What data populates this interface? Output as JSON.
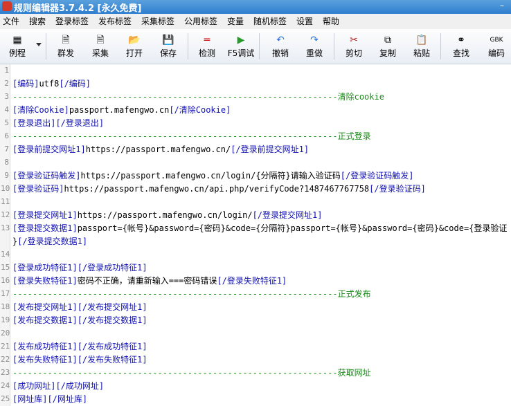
{
  "window": {
    "title": "规则编辑器3.7.4.2 [永久免费]"
  },
  "menu": [
    "文件",
    "搜索",
    "登录标签",
    "发布标签",
    "采集标签",
    "公用标签",
    "变量",
    "随机标签",
    "设置",
    "帮助"
  ],
  "toolbar": [
    {
      "label": "例程",
      "icon": "grid-icon"
    },
    {
      "label": "群发",
      "icon": "document-icon"
    },
    {
      "label": "采集",
      "icon": "document-icon"
    },
    {
      "label": "打开",
      "icon": "folder-open-icon"
    },
    {
      "label": "保存",
      "icon": "save-icon"
    },
    {
      "label": "检测",
      "icon": "check-icon"
    },
    {
      "label": "F5调试",
      "icon": "play-icon"
    },
    {
      "label": "撤销",
      "icon": "undo-icon"
    },
    {
      "label": "重做",
      "icon": "redo-icon"
    },
    {
      "label": "剪切",
      "icon": "scissors-icon"
    },
    {
      "label": "复制",
      "icon": "copy-icon"
    },
    {
      "label": "粘贴",
      "icon": "paste-icon"
    },
    {
      "label": "查找",
      "icon": "binoculars-icon"
    },
    {
      "label": "编码",
      "icon": "encoding-icon",
      "icon_text": "GBK"
    }
  ],
  "editor": {
    "lines": [
      {
        "no": "1",
        "text": ""
      },
      {
        "no": "2",
        "text": "[编码]utf8[/编码]"
      },
      {
        "no": "3",
        "text": "-----------------------------------------------------------------清除cookie"
      },
      {
        "no": "4",
        "text": "[清除Cookie]passport.mafengwo.cn[/清除Cookie]"
      },
      {
        "no": "5",
        "text": "[登录退出][/登录退出]"
      },
      {
        "no": "6",
        "text": "-----------------------------------------------------------------正式登录"
      },
      {
        "no": "7",
        "text": "[登录前提交网址1]https://passport.mafengwo.cn/[/登录前提交网址1]"
      },
      {
        "no": "8",
        "text": ""
      },
      {
        "no": "9",
        "text": "[登录验证码触发]https://passport.mafengwo.cn/login/{分隔符}请输入验证码[/登录验证码触发]"
      },
      {
        "no": "10",
        "text": "[登录验证码]https://passport.mafengwo.cn/api.php/verifyCode?1487467767758[/登录验证码]"
      },
      {
        "no": "11",
        "text": ""
      },
      {
        "no": "12",
        "text": "[登录提交网址1]https://passport.mafengwo.cn/login/[/登录提交网址1]"
      },
      {
        "no": "13",
        "text": "[登录提交数据1]passport={帐号}&password={密码}&code={分隔符}passport={帐号}&password={密码}&code={登录验证"
      },
      {
        "no": "",
        "text": "}[/登录提交数据1]"
      },
      {
        "no": "14",
        "text": ""
      },
      {
        "no": "15",
        "text": "[登录成功特征1][/登录成功特征1]"
      },
      {
        "no": "16",
        "text": "[登录失败特征1]密码不正确，请重新输入===密码错误[/登录失败特征1]"
      },
      {
        "no": "17",
        "text": "-----------------------------------------------------------------正式发布"
      },
      {
        "no": "18",
        "text": "[发布提交网址1][/发布提交网址1]"
      },
      {
        "no": "19",
        "text": "[发布提交数据1][/发布提交数据1]"
      },
      {
        "no": "20",
        "text": ""
      },
      {
        "no": "21",
        "text": "[发布成功特征1][/发布成功特征1]"
      },
      {
        "no": "22",
        "text": "[发布失败特征1][/发布失败特征1]"
      },
      {
        "no": "23",
        "text": "-----------------------------------------------------------------获取网址"
      },
      {
        "no": "24",
        "text": "[成功网址][/成功网址]"
      },
      {
        "no": "25",
        "text": "[网址库][/网址库]"
      }
    ]
  }
}
